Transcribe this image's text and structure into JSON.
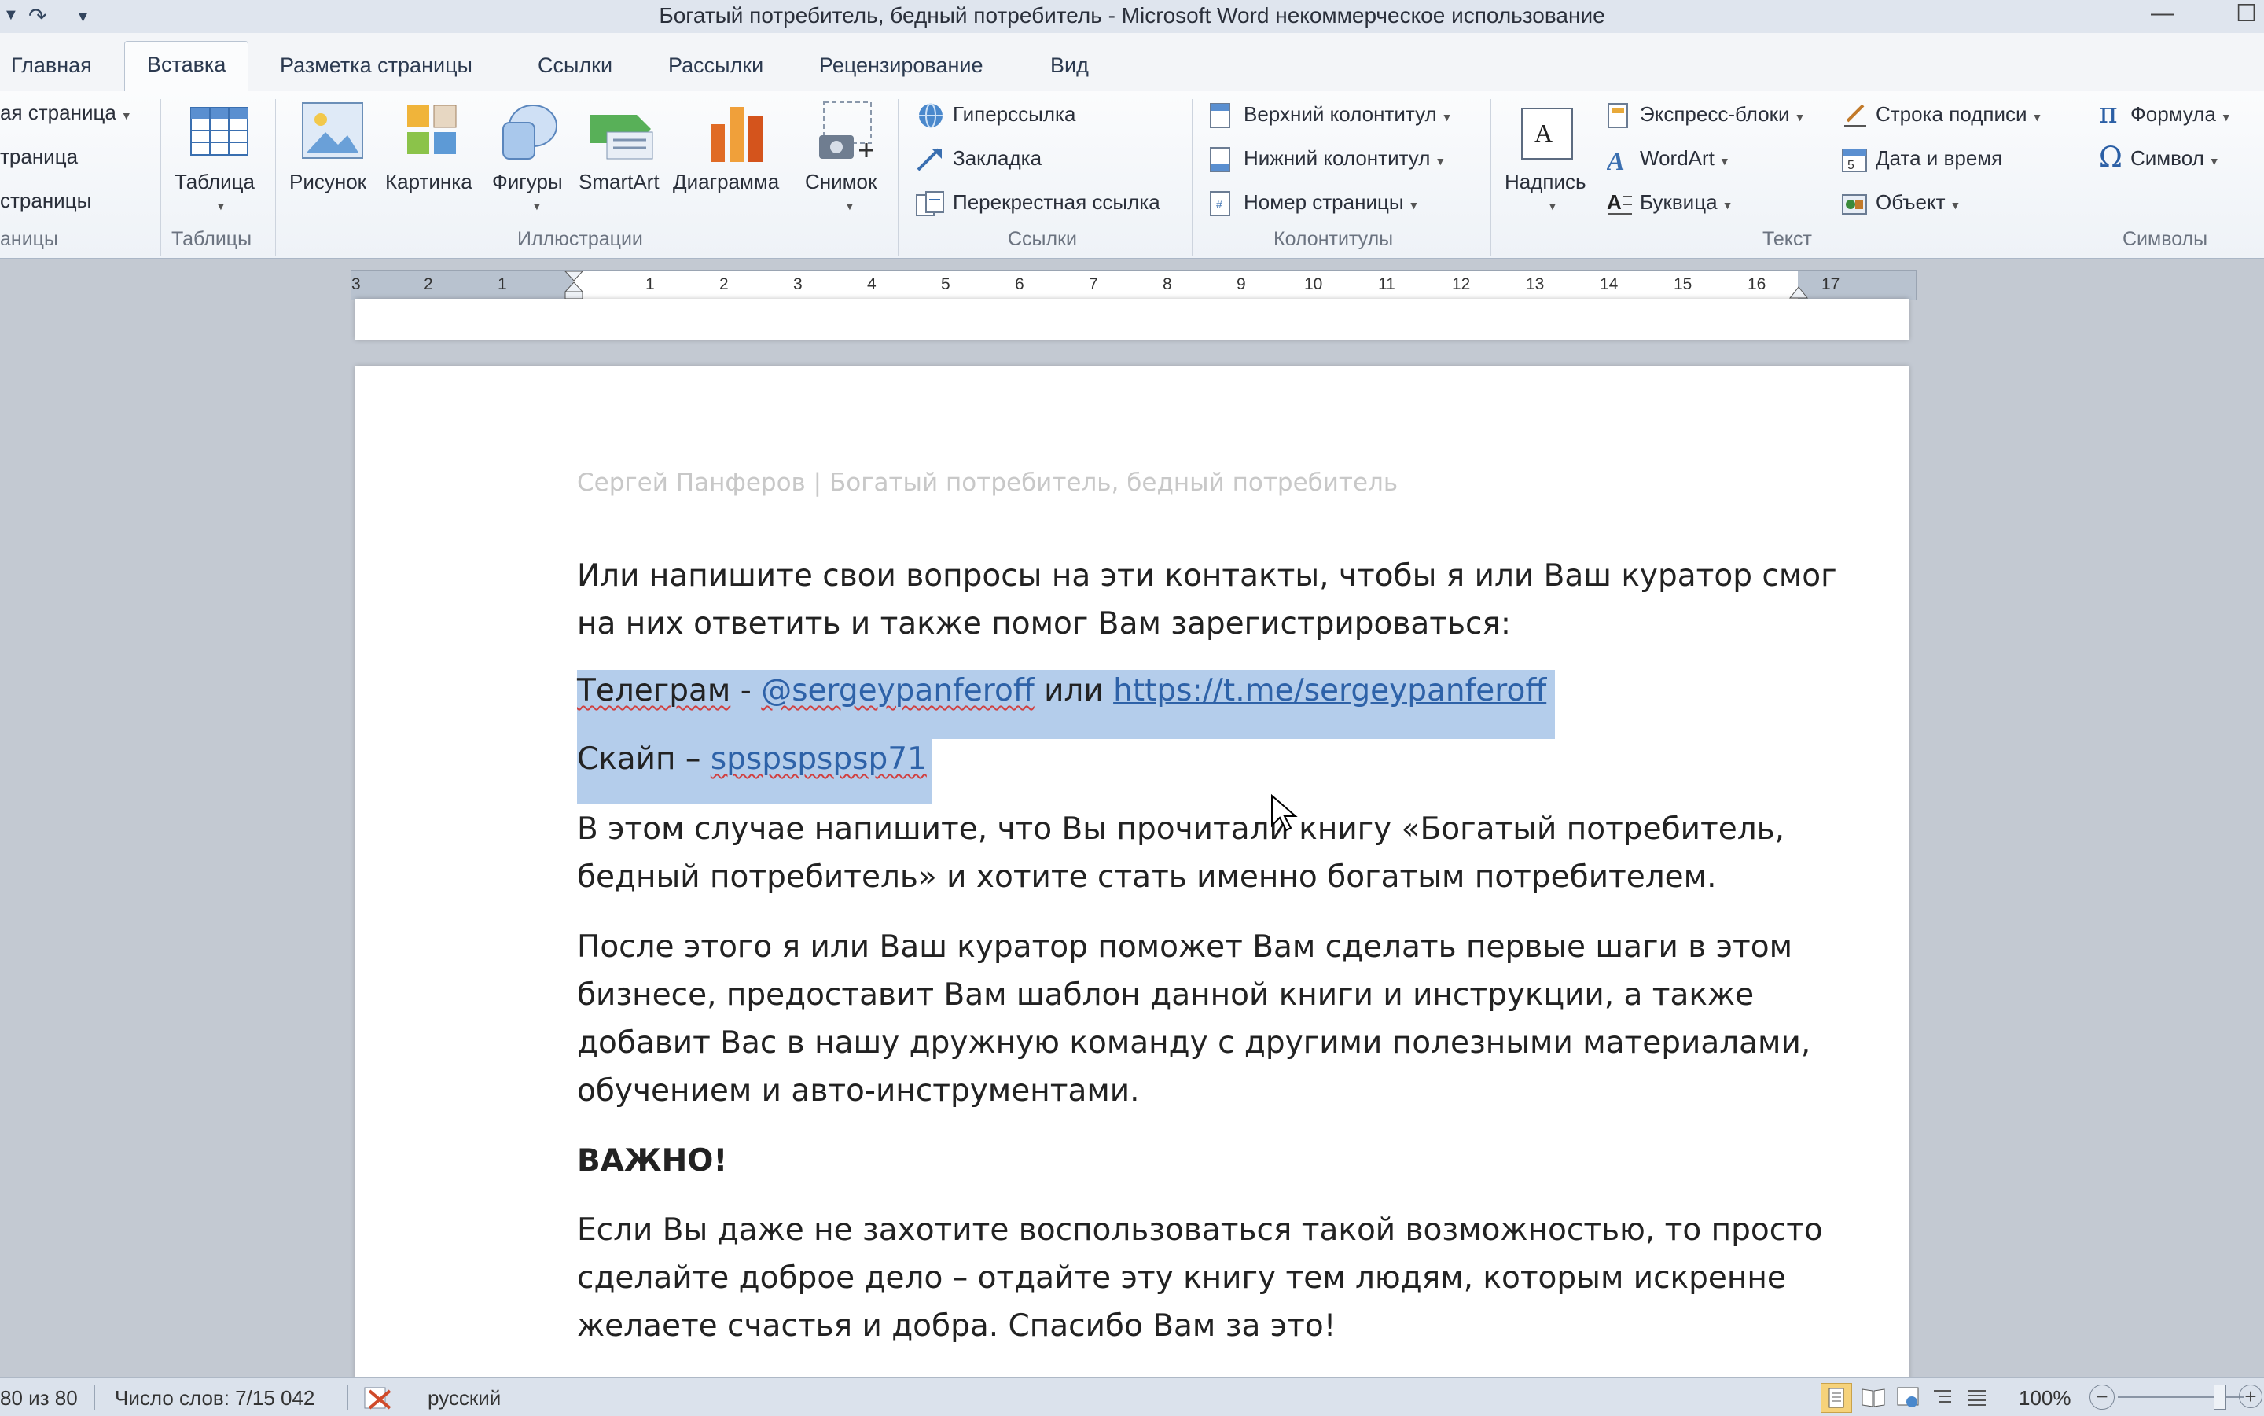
{
  "window": {
    "title": "Богатый потребитель, бедный потребитель  -  Microsoft Word некоммерческое использование",
    "qat_redo": "↷",
    "qat_custom": "▾",
    "minimize": "—",
    "maximize": "☐"
  },
  "tabs": {
    "home": "Главная",
    "insert": "Вставка",
    "page_layout": "Разметка страницы",
    "references": "Ссылки",
    "mailings": "Рассылки",
    "review": "Рецензирование",
    "view": "Вид"
  },
  "ribbon": {
    "pages": {
      "cover_page": "ая страница",
      "blank_page": "траница",
      "page_break": "страницы",
      "group": "аницы"
    },
    "tables": {
      "table": "Таблица",
      "group": "Таблицы"
    },
    "illustrations": {
      "picture": "Рисунок",
      "clipart": "Картинка",
      "shapes": "Фигуры",
      "smartart": "SmartArt",
      "chart": "Диаграмма",
      "screenshot": "Снимок",
      "group": "Иллюстрации"
    },
    "links": {
      "hyperlink": "Гиперссылка",
      "bookmark": "Закладка",
      "cross_ref": "Перекрестная ссылка",
      "group": "Ссылки"
    },
    "header_footer": {
      "header": "Верхний колонтитул",
      "footer": "Нижний колонтитул",
      "page_number": "Номер страницы",
      "group": "Колонтитулы"
    },
    "text": {
      "textbox": "Надпись",
      "quick_parts": "Экспресс-блоки",
      "wordart": "WordArt",
      "dropcap": "Буквица",
      "signature": "Строка подписи",
      "datetime": "Дата и время",
      "object": "Объект",
      "group": "Текст"
    },
    "symbols": {
      "equation": "Формула",
      "symbol": "Символ",
      "group": "Символы"
    }
  },
  "ruler": {
    "numbers": [
      "3",
      "2",
      "1",
      "1",
      "2",
      "3",
      "4",
      "5",
      "6",
      "7",
      "8",
      "9",
      "10",
      "11",
      "12",
      "13",
      "14",
      "15",
      "16",
      "17"
    ]
  },
  "document": {
    "running_header": "Сергей Панферов | Богатый потребитель, бедный потребитель",
    "para1": [
      "Или напишите свои вопросы на эти контакты, чтобы я или Ваш куратор смог",
      "на них ответить и также помог Вам зарегистрироваться:"
    ],
    "telegram": {
      "label": "Телеграм",
      "dash": " - ",
      "handle": "@sergeypanferoff",
      "or": " или ",
      "url": "https://t.me/sergeypanferoff"
    },
    "skype": {
      "label": "Скайп",
      "dash": " – ",
      "handle": "spspspspsp71"
    },
    "para2": [
      "В этом случае напишите, что Вы прочитали книгу «Богатый потребитель,",
      "бедный потребитель» и хотите стать именно богатым потребителем."
    ],
    "para3": [
      "После этого я или Ваш куратор поможет Вам сделать первые шаги в этом",
      "бизнесе, предоставит Вам шаблон данной книги и инструкции, а также",
      "добавит Вас в нашу дружную команду с другими полезными материалами,",
      "обучением и авто-инструментами."
    ],
    "important": "ВАЖНО!",
    "para4": [
      "Если Вы даже не захотите воспользоваться такой возможностью, то просто",
      "сделайте доброе дело – отдайте эту книгу тем людям, которым искренне",
      "желаете счастья и добра. Спасибо Вам за это!"
    ]
  },
  "status": {
    "page": "80 из 80",
    "words": "Число слов: 7/15 042",
    "language": "русский",
    "zoom": "100%",
    "zoom_minus": "−",
    "zoom_plus": "+"
  },
  "colors": {
    "accent": "#2b579a",
    "selection": "#b4cdeb",
    "link": "#2e62a8"
  }
}
